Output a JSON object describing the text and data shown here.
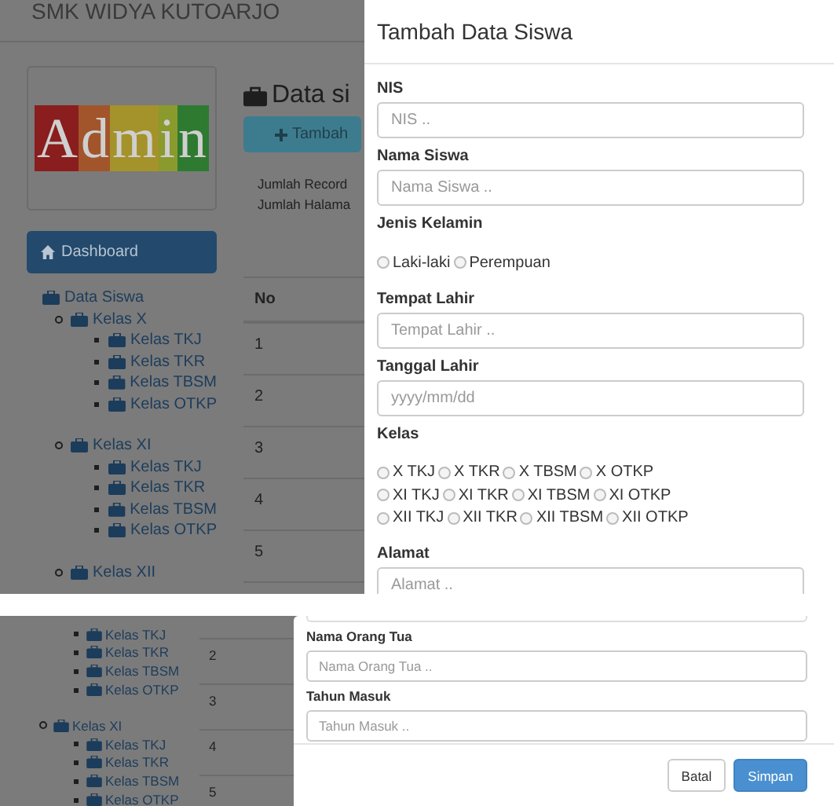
{
  "top_view": {
    "header": {
      "title": "SMK WIDYA KUTOARJO"
    },
    "sidebar": {
      "logo_text": "Admin",
      "dashboard": "Dashboard",
      "tree": [
        {
          "label": "Data Siswa",
          "children": [
            {
              "label": "Kelas X",
              "children": [
                {
                  "label": "Kelas TKJ"
                },
                {
                  "label": "Kelas TKR"
                },
                {
                  "label": "Kelas TBSM"
                },
                {
                  "label": "Kelas OTKP"
                }
              ]
            },
            {
              "label": "Kelas XI",
              "children": [
                {
                  "label": "Kelas TKJ"
                },
                {
                  "label": "Kelas TKR"
                },
                {
                  "label": "Kelas TBSM"
                },
                {
                  "label": "Kelas OTKP"
                }
              ]
            },
            {
              "label": "Kelas XII"
            }
          ]
        }
      ]
    },
    "main": {
      "title": "Data si",
      "add_button": "Tambah",
      "info": [
        "Jumlah Record",
        "Jumlah Halama"
      ],
      "table": {
        "columns": [
          "No"
        ],
        "rows": [
          [
            "1"
          ],
          [
            "2"
          ],
          [
            "3"
          ],
          [
            "4"
          ],
          [
            "5"
          ]
        ]
      }
    },
    "modal": {
      "title": "Tambah Data Siswa",
      "fields": [
        {
          "kind": "text",
          "label": "NIS",
          "placeholder": "NIS .."
        },
        {
          "kind": "text",
          "label": "Nama Siswa",
          "placeholder": "Nama Siswa .."
        },
        {
          "kind": "radio",
          "label": "Jenis Kelamin",
          "rows": [
            [
              {
                "label": "Laki-laki",
                "selected": false
              },
              {
                "label": "Perempuan",
                "selected": false
              }
            ]
          ]
        },
        {
          "kind": "text",
          "label": "Tempat Lahir",
          "placeholder": "Tempat Lahir .."
        },
        {
          "kind": "text",
          "label": "Tanggal Lahir",
          "placeholder": "yyyy/mm/dd"
        },
        {
          "kind": "radio",
          "label": "Kelas",
          "rows": [
            [
              {
                "label": "X TKJ",
                "selected": false
              },
              {
                "label": "X TKR",
                "selected": false
              },
              {
                "label": "X TBSM",
                "selected": false
              },
              {
                "label": "X OTKP",
                "selected": false
              }
            ],
            [
              {
                "label": "XI TKJ",
                "selected": false
              },
              {
                "label": "XI TKR",
                "selected": false
              },
              {
                "label": "XI TBSM",
                "selected": false
              },
              {
                "label": "XI OTKP",
                "selected": false
              }
            ],
            [
              {
                "label": "XII TKJ",
                "selected": false
              },
              {
                "label": "XII TKR",
                "selected": false
              },
              {
                "label": "XII TBSM",
                "selected": false
              },
              {
                "label": "XII OTKP",
                "selected": false
              }
            ]
          ]
        },
        {
          "kind": "text",
          "label": "Alamat",
          "placeholder": "Alamat .."
        }
      ]
    }
  },
  "bottom_view": {
    "sidebar": {
      "tree": [
        {
          "children": [
            {
              "label": "Kelas TKJ"
            },
            {
              "label": "Kelas TKR"
            },
            {
              "label": "Kelas TBSM"
            },
            {
              "label": "Kelas OTKP"
            }
          ]
        },
        {
          "label": "Kelas XI",
          "children": [
            {
              "label": "Kelas TKJ"
            },
            {
              "label": "Kelas TKR"
            },
            {
              "label": "Kelas TBSM"
            },
            {
              "label": "Kelas OTKP"
            }
          ]
        }
      ]
    },
    "table": {
      "rows": [
        [
          "2"
        ],
        [
          "3"
        ],
        [
          "4"
        ],
        [
          "5"
        ]
      ]
    },
    "modal": {
      "fields": [
        {
          "kind": "text",
          "label": "Nama Orang Tua",
          "placeholder": "Nama Orang Tua .."
        },
        {
          "kind": "text",
          "label": "Tahun Masuk",
          "placeholder": "Tahun Masuk .."
        }
      ],
      "buttons": [
        {
          "label": "Batal",
          "kind": "default"
        },
        {
          "label": "Simpan",
          "kind": "primary"
        }
      ]
    }
  }
}
